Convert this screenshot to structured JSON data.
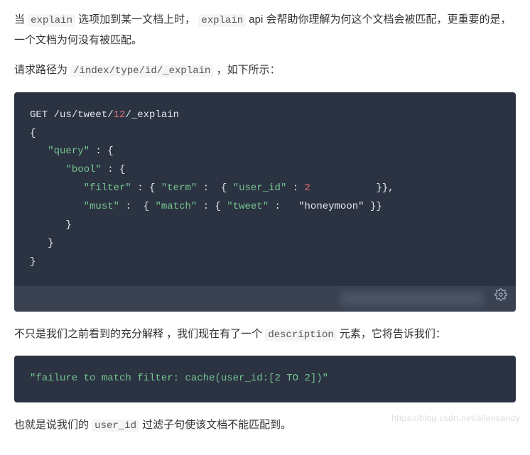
{
  "p1": {
    "t1": "当 ",
    "code1": "explain",
    "t2": " 选项加到某一文档上时， ",
    "code2": "explain",
    "t3": " api 会帮助你理解为何这个文档会被匹配，更重要的是，一个文档为何没有被匹配。"
  },
  "p2": {
    "t1": "请求路径为 ",
    "code1": "/index/type/id/_explain",
    "t2": " ，如下所示："
  },
  "code1": {
    "l1_method": "GET",
    "l1_path1": " /us/tweet/",
    "l1_id": "12",
    "l1_path2": "/_explain",
    "l2": "{",
    "l3a": "   ",
    "l3b": "\"query\"",
    "l3c": " : {",
    "l4a": "      ",
    "l4b": "\"bool\"",
    "l4c": " : {",
    "l5a": "         ",
    "l5b": "\"filter\"",
    "l5c": " : { ",
    "l5d": "\"term\"",
    "l5e": " :  { ",
    "l5f": "\"user_id\"",
    "l5g": " : ",
    "l5h": "2",
    "l5i": "           }},",
    "l6a": "         ",
    "l6b": "\"must\"",
    "l6c": " :  { ",
    "l6d": "\"match\"",
    "l6e": " : { ",
    "l6f": "\"tweet\"",
    "l6g": " :   ",
    "l6h": "\"honeymoon\"",
    "l6i": " }}",
    "l7": "      }",
    "l8": "   }",
    "l9": "}"
  },
  "p3": {
    "t1": "不只是我们之前看到的充分解释 ，我们现在有了一个 ",
    "code1": "description",
    "t2": " 元素，它将告诉我们："
  },
  "code2": {
    "line": "\"failure to match filter: cache(user_id:[2 TO 2])\""
  },
  "p4": {
    "t1": "也就是说我们的 ",
    "code1": "user_id",
    "t2": " 过滤子句使该文档不能匹配到。"
  },
  "watermark": "https://blog.csdn.net/allensandy"
}
